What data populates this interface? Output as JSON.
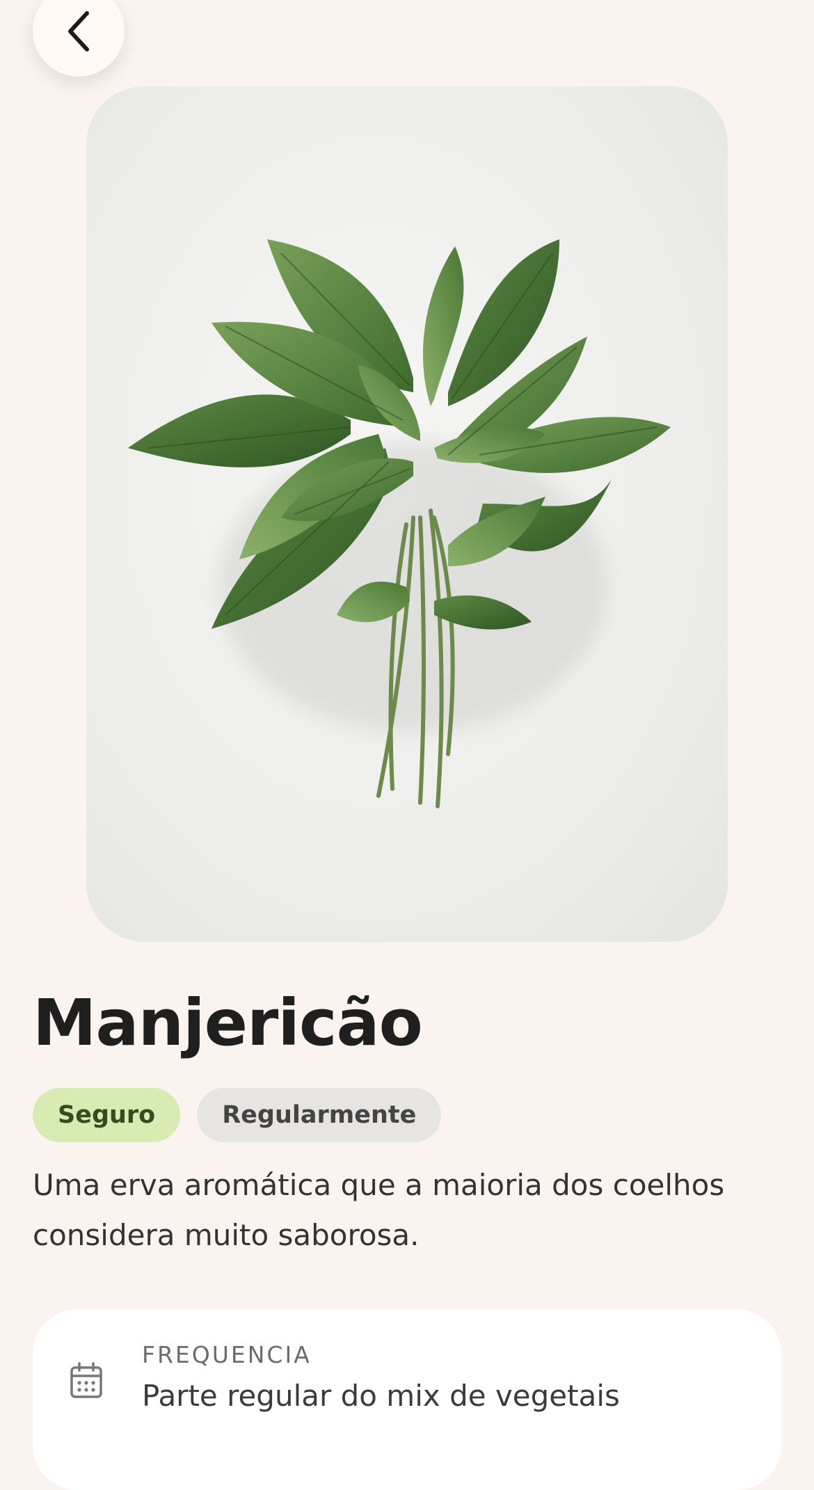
{
  "navigation": {
    "back_icon": "chevron-left-icon"
  },
  "hero": {
    "image_subject": "basil-bunch"
  },
  "item": {
    "title": "Manjericão",
    "badges": [
      {
        "label": "Seguro",
        "color": "#d8ebb3",
        "text_color": "#3a4a1f"
      },
      {
        "label": "Regularmente",
        "color": "#e7e5e3",
        "text_color": "#444444"
      }
    ],
    "description": "Uma erva aromática que a maioria dos coelhos considera muito saborosa."
  },
  "info_card": {
    "icon": "calendar-icon",
    "label": "FREQUENCIA",
    "value": "Parte regular do mix de vegetais"
  },
  "colors": {
    "background": "#fbf3ef",
    "card": "#ffffff",
    "title": "#1f1f1f"
  }
}
